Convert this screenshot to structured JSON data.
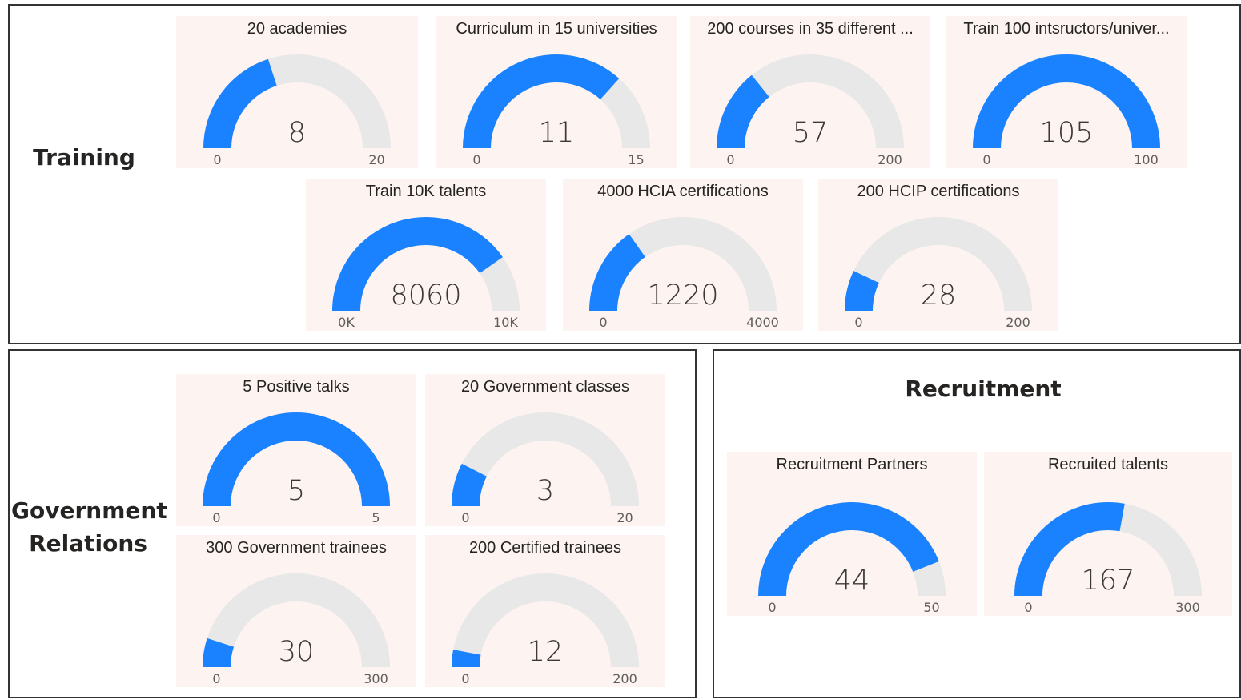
{
  "colors": {
    "fill": "#1a82ff",
    "track": "#e8e8e8",
    "card_bg": "#fdf4f1",
    "border": "#333333"
  },
  "sections": {
    "training": {
      "title": "Training"
    },
    "government": {
      "title_line1": "Government",
      "title_line2": "Relations"
    },
    "recruitment": {
      "title": "Recruitment"
    }
  },
  "chart_data": [
    {
      "type": "gauge",
      "section": "Training",
      "title": "20 academies",
      "value": 8,
      "min": 0,
      "max": 20,
      "value_label": "8",
      "min_label": "0",
      "max_label": "20"
    },
    {
      "type": "gauge",
      "section": "Training",
      "title": "Curriculum in 15 universities",
      "value": 11,
      "min": 0,
      "max": 15,
      "value_label": "11",
      "min_label": "0",
      "max_label": "15"
    },
    {
      "type": "gauge",
      "section": "Training",
      "title": "200 courses in 35 different ...",
      "value": 57,
      "min": 0,
      "max": 200,
      "value_label": "57",
      "min_label": "0",
      "max_label": "200"
    },
    {
      "type": "gauge",
      "section": "Training",
      "title": "Train 100 intsructors/univer...",
      "value": 105,
      "min": 0,
      "max": 100,
      "value_label": "105",
      "min_label": "0",
      "max_label": "100"
    },
    {
      "type": "gauge",
      "section": "Training",
      "title": "Train 10K talents",
      "value": 8060,
      "min": 0,
      "max": 10000,
      "value_label": "8060",
      "min_label": "0K",
      "max_label": "10K"
    },
    {
      "type": "gauge",
      "section": "Training",
      "title": "4000 HCIA certifications",
      "value": 1220,
      "min": 0,
      "max": 4000,
      "value_label": "1220",
      "min_label": "0",
      "max_label": "4000"
    },
    {
      "type": "gauge",
      "section": "Training",
      "title": "200 HCIP certifications",
      "value": 28,
      "min": 0,
      "max": 200,
      "value_label": "28",
      "min_label": "0",
      "max_label": "200"
    },
    {
      "type": "gauge",
      "section": "Government Relations",
      "title": "5 Positive talks",
      "value": 5,
      "min": 0,
      "max": 5,
      "value_label": "5",
      "min_label": "0",
      "max_label": "5"
    },
    {
      "type": "gauge",
      "section": "Government Relations",
      "title": "20 Government classes",
      "value": 3,
      "min": 0,
      "max": 20,
      "value_label": "3",
      "min_label": "0",
      "max_label": "20"
    },
    {
      "type": "gauge",
      "section": "Government Relations",
      "title": "300 Government trainees",
      "value": 30,
      "min": 0,
      "max": 300,
      "value_label": "30",
      "min_label": "0",
      "max_label": "300"
    },
    {
      "type": "gauge",
      "section": "Government Relations",
      "title": "200 Certified trainees",
      "value": 12,
      "min": 0,
      "max": 200,
      "value_label": "12",
      "min_label": "0",
      "max_label": "200"
    },
    {
      "type": "gauge",
      "section": "Recruitment",
      "title": "Recruitment Partners",
      "value": 44,
      "min": 0,
      "max": 50,
      "value_label": "44",
      "min_label": "0",
      "max_label": "50"
    },
    {
      "type": "gauge",
      "section": "Recruitment",
      "title": "Recruited talents",
      "value": 167,
      "min": 0,
      "max": 300,
      "value_label": "167",
      "min_label": "0",
      "max_label": "300"
    }
  ]
}
